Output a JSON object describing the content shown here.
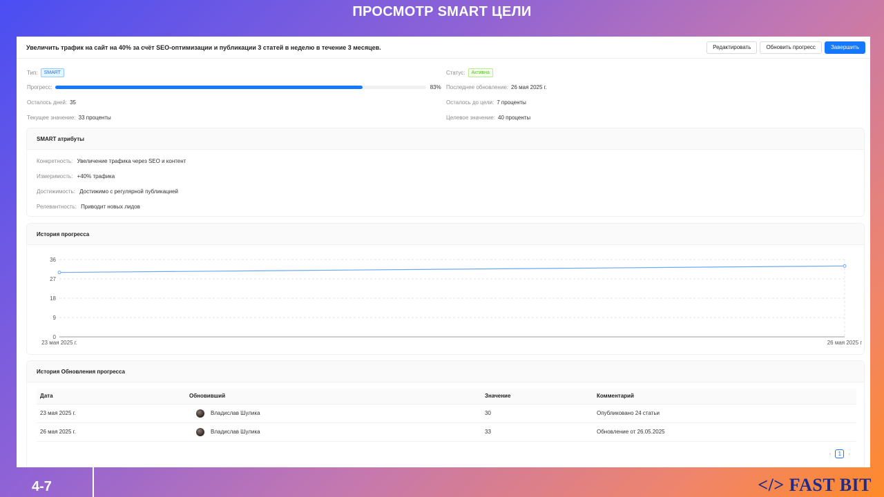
{
  "slide": {
    "title": "ПРОСМОТР SMART ЦЕЛИ",
    "number": "4-7",
    "brand": "</> FAST BIT"
  },
  "header": {
    "goal": "Увеличить трафик на сайт на 40% за счёт SEO-оптимизации и публикации 3 статей в неделю в течение 3 месяцев.",
    "buttons": {
      "edit": "Редактировать",
      "update": "Обновить прогресс",
      "finish": "Завершить"
    }
  },
  "details": {
    "type_label": "Тип:",
    "type_value": "SMART",
    "status_label": "Статус:",
    "status_value": "Активна",
    "progress_label": "Прогресс:",
    "progress_percent": 83,
    "progress_text": "83%",
    "updated_label": "Последнее обновление:",
    "updated_value": "26 мая 2025 г.",
    "days_label": "Осталось дней:",
    "days_value": "35",
    "left_label": "Осталось до цели:",
    "left_value": "7 проценты",
    "current_label": "Текущее значение:",
    "current_value": "33 проценты",
    "target_label": "Целевое значение:",
    "target_value": "40 проценты"
  },
  "smart": {
    "title": "SMART атрибуты",
    "items": [
      {
        "label": "Конкретность:",
        "value": "Увеличение трафика через SEO и контент"
      },
      {
        "label": "Измеримость:",
        "value": "+40% трафика"
      },
      {
        "label": "Достижимость:",
        "value": "Достижимо с регулярной публикацией"
      },
      {
        "label": "Релевантность:",
        "value": "Приводит новых лидов"
      }
    ]
  },
  "history_chart": {
    "title": "История прогресса"
  },
  "chart_data": {
    "type": "line",
    "x": [
      "23 мая 2025 г.",
      "26 мая 2025 г"
    ],
    "series": [
      {
        "values": [
          30,
          33
        ]
      }
    ],
    "ylim": [
      0,
      36
    ],
    "yticks": [
      0,
      9,
      18,
      27,
      36
    ],
    "grid": true,
    "color": "#6aa7f8"
  },
  "updates": {
    "title": "История Обновления прогресса",
    "columns": [
      "Дата",
      "Обновивший",
      "Значение",
      "Комментарий"
    ],
    "rows": [
      {
        "date": "23 мая 2025 г.",
        "user": "Владислав Шулика",
        "value": "30",
        "comment": "Опубликовано 24 статьи"
      },
      {
        "date": "26 мая 2025 г.",
        "user": "Владислав Шулика",
        "value": "33",
        "comment": "Обновление от 26.05.2025"
      }
    ],
    "page": "1",
    "prev": "‹",
    "next": "›"
  }
}
